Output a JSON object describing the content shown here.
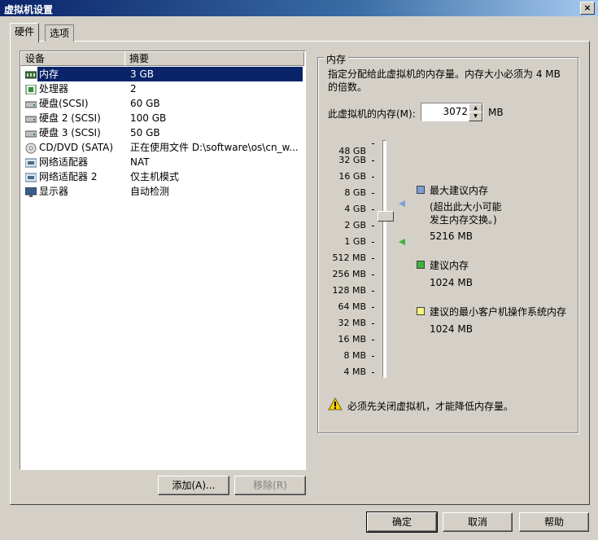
{
  "window": {
    "title": "虚拟机设置",
    "close_label": "×"
  },
  "tabs": [
    {
      "label": "硬件"
    },
    {
      "label": "选项"
    }
  ],
  "device_list": {
    "headers": [
      "设备",
      "摘要"
    ],
    "rows": [
      {
        "name": "内存",
        "summary": "3 GB",
        "icon": "memory-icon",
        "selected": true
      },
      {
        "name": "处理器",
        "summary": "2",
        "icon": "cpu-icon"
      },
      {
        "name": "硬盘(SCSI)",
        "summary": "60 GB",
        "icon": "disk-icon"
      },
      {
        "name": "硬盘 2 (SCSI)",
        "summary": "100 GB",
        "icon": "disk-icon"
      },
      {
        "name": "硬盘 3 (SCSI)",
        "summary": "50 GB",
        "icon": "disk-icon"
      },
      {
        "name": "CD/DVD (SATA)",
        "summary": "正在使用文件 D:\\software\\os\\cn_w...",
        "icon": "cd-icon"
      },
      {
        "name": "网络适配器",
        "summary": "NAT",
        "icon": "network-icon"
      },
      {
        "name": "网络适配器 2",
        "summary": "仅主机模式",
        "icon": "network-icon"
      },
      {
        "name": "显示器",
        "summary": "自动检测",
        "icon": "monitor-icon"
      }
    ],
    "add_button": "添加(A)...",
    "remove_button": "移除(R)"
  },
  "memory": {
    "group_title": "内存",
    "description": "指定分配给此虚拟机的内存量。内存大小必须为 4 MB 的倍数。",
    "field_label": "此虚拟机的内存(M):",
    "value": "3072",
    "unit": "MB",
    "scale": [
      "48 GB",
      "32 GB",
      "16 GB",
      "8 GB",
      "4 GB",
      "2 GB",
      "1 GB",
      "512 MB",
      "256 MB",
      "128 MB",
      "64 MB",
      "32 MB",
      "16 MB",
      "8 MB",
      "4 MB"
    ],
    "legend": {
      "max": {
        "label": "最大建议内存",
        "note": "(超出此大小可能发生内存交换。)",
        "value": "5216 MB",
        "color": "#7b9ed6"
      },
      "recommended": {
        "label": "建议内存",
        "value": "1024 MB",
        "color": "#3cb43c"
      },
      "guest_min": {
        "label": "建议的最小客户机操作系统内存",
        "value": "1024 MB",
        "color": "#f7f37c"
      }
    },
    "warning": "必须先关闭虚拟机，才能降低内存量。"
  },
  "footer": {
    "ok": "确定",
    "cancel": "取消",
    "help": "帮助"
  }
}
